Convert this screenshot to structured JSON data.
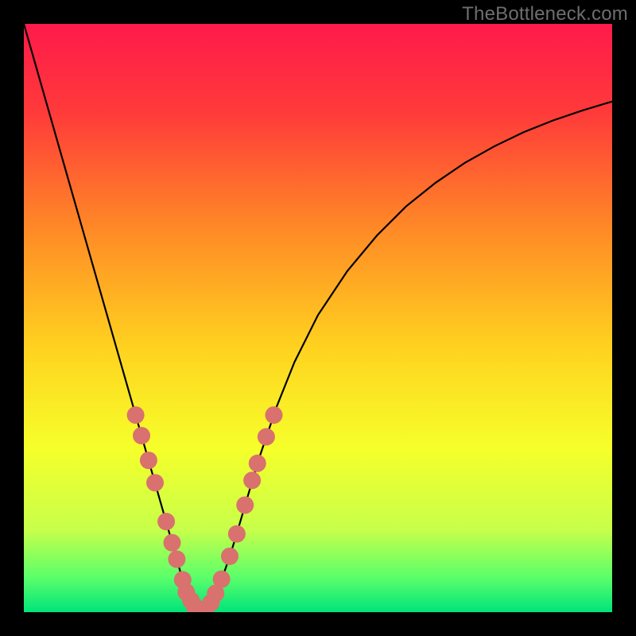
{
  "watermark": "TheBottleneck.com",
  "chart_data": {
    "type": "line",
    "title": "",
    "xlabel": "",
    "ylabel": "",
    "xlim": [
      0,
      1
    ],
    "ylim": [
      0,
      1
    ],
    "background_gradient": {
      "stops": [
        {
          "offset": 0.0,
          "color": "#ff1a4b"
        },
        {
          "offset": 0.15,
          "color": "#ff3a3a"
        },
        {
          "offset": 0.35,
          "color": "#ff8a26"
        },
        {
          "offset": 0.55,
          "color": "#ffd21f"
        },
        {
          "offset": 0.72,
          "color": "#f6ff2a"
        },
        {
          "offset": 0.86,
          "color": "#c7ff4a"
        },
        {
          "offset": 0.94,
          "color": "#5cff6a"
        },
        {
          "offset": 1.0,
          "color": "#00e47a"
        }
      ]
    },
    "series": [
      {
        "name": "bottleneck-curve",
        "color": "#000000",
        "x": [
          0.0,
          0.02,
          0.04,
          0.06,
          0.08,
          0.1,
          0.12,
          0.14,
          0.16,
          0.18,
          0.2,
          0.21,
          0.22,
          0.23,
          0.24,
          0.25,
          0.26,
          0.265,
          0.27,
          0.275,
          0.28,
          0.285,
          0.29,
          0.295,
          0.3,
          0.305,
          0.31,
          0.32,
          0.33,
          0.34,
          0.35,
          0.36,
          0.38,
          0.4,
          0.43,
          0.46,
          0.5,
          0.55,
          0.6,
          0.65,
          0.7,
          0.75,
          0.8,
          0.85,
          0.9,
          0.95,
          1.0
        ],
        "y": [
          1.0,
          0.93,
          0.86,
          0.79,
          0.72,
          0.65,
          0.58,
          0.51,
          0.44,
          0.37,
          0.3,
          0.265,
          0.23,
          0.195,
          0.16,
          0.125,
          0.09,
          0.072,
          0.055,
          0.04,
          0.028,
          0.018,
          0.01,
          0.005,
          0.002,
          0.003,
          0.007,
          0.02,
          0.04,
          0.066,
          0.095,
          0.127,
          0.195,
          0.262,
          0.35,
          0.425,
          0.505,
          0.58,
          0.64,
          0.69,
          0.73,
          0.764,
          0.792,
          0.816,
          0.836,
          0.853,
          0.868
        ]
      }
    ],
    "markers": {
      "name": "highlighted-points",
      "color": "#d9716e",
      "radius": 11,
      "points": [
        {
          "x": 0.19,
          "y": 0.335
        },
        {
          "x": 0.2,
          "y": 0.3
        },
        {
          "x": 0.212,
          "y": 0.258
        },
        {
          "x": 0.223,
          "y": 0.22
        },
        {
          "x": 0.242,
          "y": 0.154
        },
        {
          "x": 0.252,
          "y": 0.118
        },
        {
          "x": 0.26,
          "y": 0.09
        },
        {
          "x": 0.27,
          "y": 0.055
        },
        {
          "x": 0.276,
          "y": 0.034
        },
        {
          "x": 0.284,
          "y": 0.02
        },
        {
          "x": 0.29,
          "y": 0.01
        },
        {
          "x": 0.298,
          "y": 0.004
        },
        {
          "x": 0.308,
          "y": 0.005
        },
        {
          "x": 0.318,
          "y": 0.016
        },
        {
          "x": 0.326,
          "y": 0.032
        },
        {
          "x": 0.336,
          "y": 0.056
        },
        {
          "x": 0.35,
          "y": 0.095
        },
        {
          "x": 0.362,
          "y": 0.133
        },
        {
          "x": 0.376,
          "y": 0.182
        },
        {
          "x": 0.388,
          "y": 0.224
        },
        {
          "x": 0.397,
          "y": 0.253
        },
        {
          "x": 0.412,
          "y": 0.298
        },
        {
          "x": 0.425,
          "y": 0.335
        }
      ]
    }
  }
}
